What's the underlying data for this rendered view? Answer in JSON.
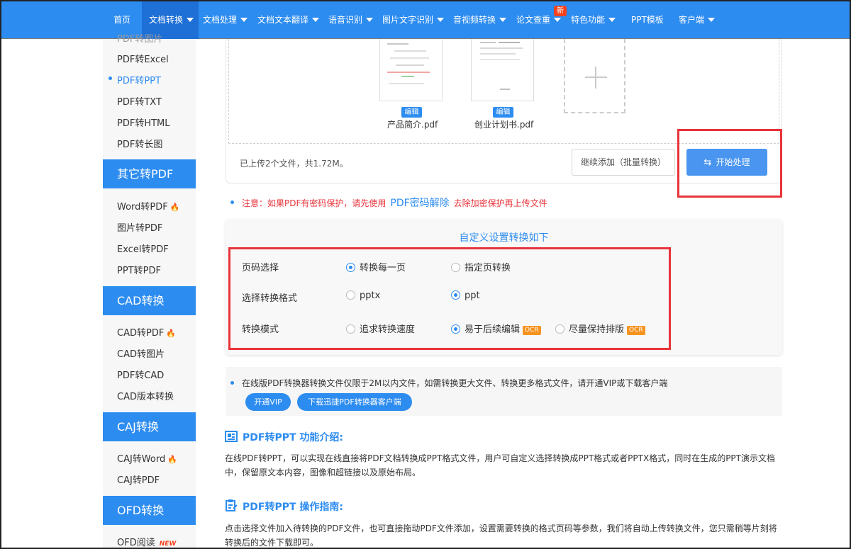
{
  "nav": {
    "items": [
      {
        "label": "首页",
        "caret": false
      },
      {
        "label": "文档转换",
        "caret": true
      },
      {
        "label": "文档处理",
        "caret": true
      },
      {
        "label": "文档文本翻译",
        "caret": true
      },
      {
        "label": "语音识别",
        "caret": true
      },
      {
        "label": "图片文字识别",
        "caret": true
      },
      {
        "label": "音视频转换",
        "caret": true
      },
      {
        "label": "论文查重",
        "caret": true
      },
      {
        "label": "特色功能",
        "caret": true
      },
      {
        "label": "PPT模板",
        "caret": false
      },
      {
        "label": "客户端",
        "caret": true
      }
    ],
    "new_badge": "新"
  },
  "sidebar": {
    "partial_top": "PDF转图片",
    "pdf_links": [
      "PDF转Excel",
      "PDF转PPT",
      "PDF转TXT",
      "PDF转HTML",
      "PDF转长图"
    ],
    "other_head": "其它转PDF",
    "other_links": [
      "Word转PDF",
      "图片转PDF",
      "Excel转PDF",
      "PPT转PDF"
    ],
    "cad_head": "CAD转换",
    "cad_links": [
      "CAD转PDF",
      "CAD转图片",
      "PDF转CAD",
      "CAD版本转换"
    ],
    "caj_head": "CAJ转换",
    "caj_links": [
      "CAJ转Word",
      "CAJ转PDF"
    ],
    "ofd_head": "OFD转换",
    "ofd_links": [
      "OFD阅读"
    ],
    "new_tag": "NEW"
  },
  "upload": {
    "files": [
      {
        "name": "产品简介.pdf",
        "edit": "编辑"
      },
      {
        "name": "创业计划书.pdf",
        "edit": "编辑"
      }
    ],
    "info": "已上传2个文件，共1.72M。",
    "continue_label": "继续添加（批量转换）",
    "start_label": "开始处理"
  },
  "notice": {
    "prefix": "注意：如果PDF有密码保护，请先使用",
    "link": "PDF密码解除",
    "suffix": "去除加密保护再上传文件"
  },
  "settings": {
    "title": "自定义设置转换如下",
    "rows": [
      {
        "label": "页码选择",
        "options": [
          "转换每一页",
          "指定页转换"
        ],
        "selected": 0
      },
      {
        "label": "选择转换格式",
        "options": [
          "pptx",
          "ppt"
        ],
        "selected": 1
      },
      {
        "label": "转换模式",
        "options": [
          "追求转换速度",
          "易于后续编辑",
          "尽量保持排版"
        ],
        "selected": 1
      }
    ],
    "ocr": "OCR"
  },
  "vip": {
    "text": "在线版PDF转换器转换文件仅限于2M以内文件，如需转换更大文件、转换更多格式文件，请开通VIP或下载客户端",
    "open_vip": "开通VIP",
    "download_client": "下载迅捷PDF转换器客户端"
  },
  "intro": {
    "title": "PDF转PPT 功能介绍:",
    "text": "在线PDF转PPT，可以实现在线直接将PDF文档转换成PPT格式文件，用户可自定义选择转换成PPT格式或者PPTX格式，同时在生成的PPT演示文档中，保留原文本内容，图像和超链接以及原始布局。"
  },
  "guide": {
    "title": "PDF转PPT 操作指南:",
    "text": "点击选择文件加入待转换的PDF文件，也可直接拖动PDF文件添加，设置需要转换的格式页码等参数，我们将自动上传转换文件，您只需稍等片刻将转换后的文件下载即可。"
  },
  "colors": {
    "primary": "#2d8cf0",
    "alert": "#e8333a",
    "ocr": "#f7931e"
  }
}
